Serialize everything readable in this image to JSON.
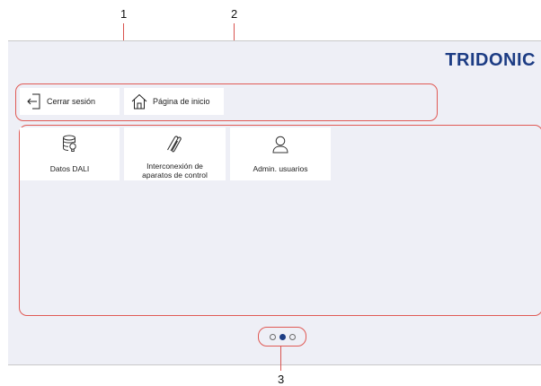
{
  "callouts": [
    "1",
    "2",
    "3"
  ],
  "brand": "TRIDONIC",
  "nav": {
    "logout_label": "Cerrar sesión",
    "home_label": "Página de inicio"
  },
  "apps": [
    {
      "label": "Datos DALI",
      "icon": "database-bulb-icon"
    },
    {
      "label": "Interconexión de aparatos de control",
      "icon": "paperclip-icon"
    },
    {
      "label": "Admin. usuarios",
      "icon": "user-icon"
    }
  ],
  "pagination": {
    "pages": 3,
    "current": 2
  },
  "colors": {
    "accent": "#1c3c84",
    "callout": "#e05a55",
    "panel": "#eeeff6"
  }
}
